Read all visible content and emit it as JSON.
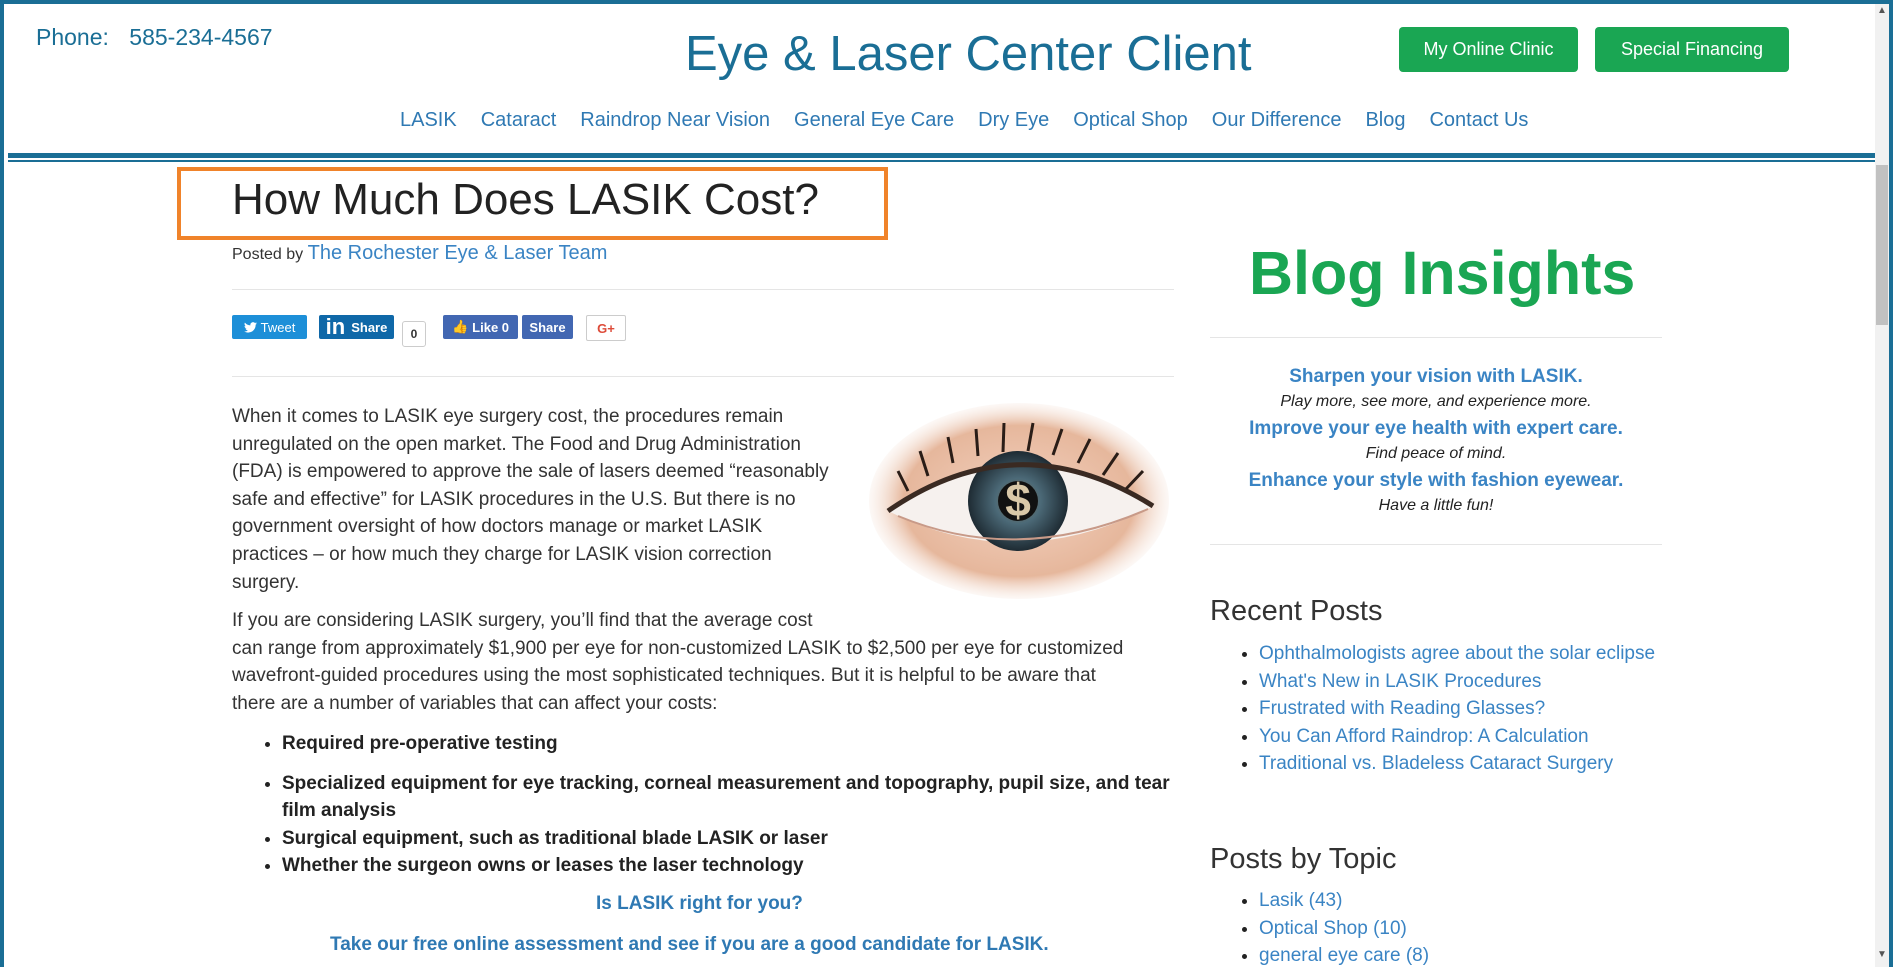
{
  "header": {
    "phone_label": "Phone:",
    "phone_number": "585-234-4567",
    "site_title": "Eye & Laser Center Client",
    "btn_clinic": "My Online Clinic",
    "btn_financing": "Special Financing"
  },
  "nav": {
    "items": [
      "LASIK",
      "Cataract",
      "Raindrop Near Vision",
      "General Eye Care",
      "Dry Eye",
      "Optical Shop",
      "Our Difference",
      "Blog",
      "Contact Us"
    ]
  },
  "post": {
    "title": "How Much Does LASIK Cost?",
    "posted_by_label": "Posted by",
    "author": "The Rochester Eye & Laser Team",
    "social": {
      "tweet": "Tweet",
      "li_share": "Share",
      "li_count": "0",
      "fb_like": "Like 0",
      "fb_share": "Share",
      "gplus": "G+"
    },
    "para1_lines": [
      "When it comes to LASIK eye surgery cost, the procedures remain",
      "unregulated on the open market. The Food and Drug Administration",
      "(FDA) is empowered to approve the sale of lasers deemed “reasonably",
      "safe and effective” for LASIK procedures in the U.S. But there is no",
      "government oversight of how doctors manage or market LASIK",
      "practices – or how much they charge for LASIK vision correction",
      "surgery."
    ],
    "para2_lines": [
      "If you are considering LASIK surgery, you’ll find that the average cost",
      "can range from approximately $1,900 per eye for non-customized LASIK to $2,500 per eye for customized",
      "wavefront-guided procedures using the most sophisticated techniques. But it is helpful to be aware that",
      "there are a number of variables that can affect your costs:"
    ],
    "bullets": [
      "Required pre-operative testing",
      "Specialized equipment for eye tracking, corneal measurement and topography, pupil size, and tear film analysis",
      "Surgical equipment, such as traditional blade LASIK or laser",
      "Whether the surgeon owns or leases the laser technology"
    ],
    "cta_question": "Is LASIK right for you?",
    "cta_text": "Take our free online assessment and see if you are a good candidate for LASIK."
  },
  "sidebar": {
    "heading": "Blog Insights",
    "insights": [
      {
        "bold": "Sharpen your vision with LASIK.",
        "italic": "Play more, see more, and experience more."
      },
      {
        "bold": "Improve your eye health with expert care.",
        "italic": "Find peace of mind."
      },
      {
        "bold": "Enhance your style with fashion eyewear.",
        "italic": "Have a little fun!"
      }
    ],
    "recent_heading": "Recent Posts",
    "recent_posts": [
      "Ophthalmologists agree about the solar eclipse",
      "What's New in LASIK Procedures",
      "Frustrated with Reading Glasses?",
      "You Can Afford Raindrop: A Calculation",
      "Traditional vs. Bladeless Cataract Surgery"
    ],
    "topics_heading": "Posts by Topic",
    "topics": [
      "Lasik (43)",
      "Optical Shop (10)",
      "general eye care (8)"
    ]
  },
  "colors": {
    "brand_blue": "#1a6e95",
    "link_blue": "#3a84c4",
    "green": "#1aa653",
    "highlight_orange": "#f0832a"
  },
  "icons": {
    "eye_image": "eye-with-dollar-sign-image",
    "twitter": "twitter-bird-icon",
    "linkedin": "linkedin-in-icon",
    "facebook": "thumbs-up-icon"
  }
}
